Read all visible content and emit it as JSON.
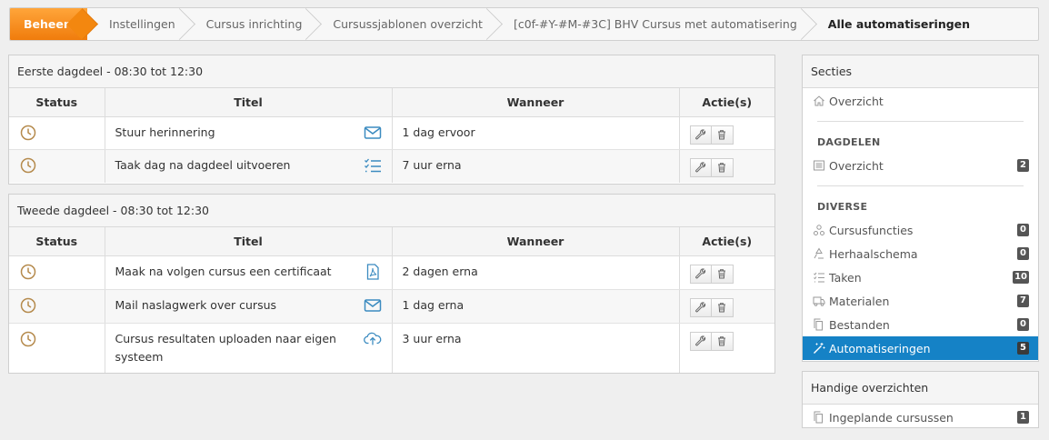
{
  "breadcrumb": [
    "Beheer",
    "Instellingen",
    "Cursus inrichting",
    "Cursussjablonen overzicht",
    "[c0f-#Y-#M-#3C] BHV Cursus met automatisering",
    "Alle automatiseringen"
  ],
  "columns": {
    "status": "Status",
    "title": "Titel",
    "when": "Wanneer",
    "actions": "Actie(s)"
  },
  "sessions": [
    {
      "heading": "Eerste dagdeel - 08:30 tot 12:30",
      "rows": [
        {
          "title": "Stuur herinnering",
          "icon": "mail-icon",
          "when": "1 dag ervoor"
        },
        {
          "title": "Taak dag na dagdeel uitvoeren",
          "icon": "tasklist-icon",
          "when": "7 uur erna"
        }
      ]
    },
    {
      "heading": "Tweede dagdeel - 08:30 tot 12:30",
      "rows": [
        {
          "title": "Maak na volgen cursus een certificaat",
          "icon": "pdf-icon",
          "when": "2 dagen erna"
        },
        {
          "title": "Mail naslagwerk over cursus",
          "icon": "mail-icon",
          "when": "1 dag erna"
        },
        {
          "title": "Cursus resultaten uploaden naar eigen systeem",
          "icon": "cloud-upload-icon",
          "when": "3 uur erna"
        }
      ]
    }
  ],
  "sidebar": {
    "title": "Secties",
    "overview": "Overzicht",
    "dagdelen_title": "DAGDELEN",
    "dagdelen_overview": {
      "label": "Overzicht",
      "count": "2"
    },
    "diverse_title": "DIVERSE",
    "diverse": [
      {
        "label": "Cursusfuncties",
        "count": "0",
        "icon": "sitemap-icon"
      },
      {
        "label": "Herhaalschema",
        "count": "0",
        "icon": "recycle-icon"
      },
      {
        "label": "Taken",
        "count": "10",
        "icon": "tasklist-icon"
      },
      {
        "label": "Materialen",
        "count": "7",
        "icon": "truck-icon"
      },
      {
        "label": "Bestanden",
        "count": "0",
        "icon": "files-icon"
      },
      {
        "label": "Automatiseringen",
        "count": "5",
        "icon": "magic-wand-icon",
        "active": true
      }
    ]
  },
  "handy": {
    "title": "Handige overzichten",
    "items": [
      {
        "label": "Ingeplande cursussen",
        "count": "1"
      }
    ]
  },
  "colors": {
    "accent": "#f07c0c",
    "active": "#1582c6",
    "status_icon": "#b58a4c",
    "type_icon": "#3b8bc0"
  }
}
